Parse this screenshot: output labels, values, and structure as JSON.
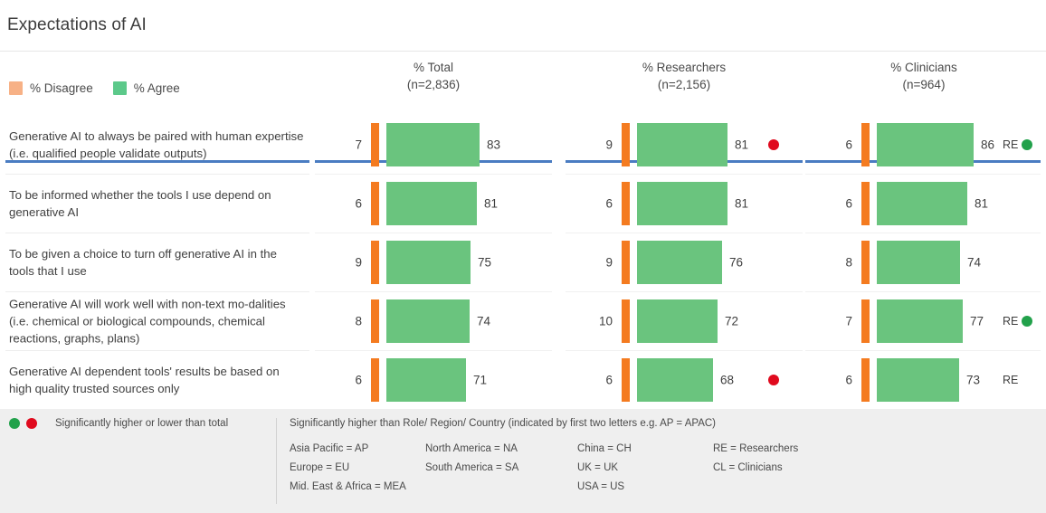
{
  "title": "Expectations of AI",
  "legend": {
    "items": [
      {
        "label": "% Disagree",
        "color": "#f7b186",
        "icon": "square-swatch"
      },
      {
        "label": "% Agree",
        "color": "#5cc98a",
        "icon": "square-swatch"
      }
    ]
  },
  "columns": [
    {
      "key": "total",
      "title": "% Total",
      "sub": "(n=2,836)"
    },
    {
      "key": "researchers",
      "title": "% Researchers",
      "sub": "(n=2,156)"
    },
    {
      "key": "clinicians",
      "title": "% Clinicians",
      "sub": "(n=964)"
    }
  ],
  "rows": [
    {
      "label": "Generative AI to always be paired with human expertise (i.e. qualified people validate outputs)",
      "cells": [
        {
          "disagree": 7,
          "agree": 83,
          "sig_label": "",
          "sig_dot": ""
        },
        {
          "disagree": 9,
          "agree": 81,
          "sig_label": "",
          "sig_dot": "red"
        },
        {
          "disagree": 6,
          "agree": 86,
          "sig_label": "RE",
          "sig_dot": "green"
        }
      ]
    },
    {
      "label": "To be informed whether the tools I use depend on generative AI",
      "cells": [
        {
          "disagree": 6,
          "agree": 81,
          "sig_label": "",
          "sig_dot": ""
        },
        {
          "disagree": 6,
          "agree": 81,
          "sig_label": "",
          "sig_dot": ""
        },
        {
          "disagree": 6,
          "agree": 81,
          "sig_label": "",
          "sig_dot": ""
        }
      ]
    },
    {
      "label": "To be given a choice to turn off generative AI in the tools that I use",
      "cells": [
        {
          "disagree": 9,
          "agree": 75,
          "sig_label": "",
          "sig_dot": ""
        },
        {
          "disagree": 9,
          "agree": 76,
          "sig_label": "",
          "sig_dot": ""
        },
        {
          "disagree": 8,
          "agree": 74,
          "sig_label": "",
          "sig_dot": ""
        }
      ]
    },
    {
      "label": "Generative AI will work well with non-text mo-dalities (i.e. chemical or biological compounds, chemical reactions, graphs, plans)",
      "cells": [
        {
          "disagree": 8,
          "agree": 74,
          "sig_label": "",
          "sig_dot": ""
        },
        {
          "disagree": 10,
          "agree": 72,
          "sig_label": "",
          "sig_dot": ""
        },
        {
          "disagree": 7,
          "agree": 77,
          "sig_label": "RE",
          "sig_dot": "green"
        }
      ]
    },
    {
      "label": "Generative AI dependent tools' results be based on high quality trusted sources only",
      "cells": [
        {
          "disagree": 6,
          "agree": 71,
          "sig_label": "",
          "sig_dot": ""
        },
        {
          "disagree": 6,
          "agree": 68,
          "sig_label": "",
          "sig_dot": "red"
        },
        {
          "disagree": 6,
          "agree": 73,
          "sig_label": "RE",
          "sig_dot": ""
        }
      ]
    }
  ],
  "footer": {
    "sig_note": "Significantly higher or lower than total",
    "sig_dots": [
      "green",
      "red"
    ],
    "heading": "Significantly higher than Role/ Region/ Country (indicated by first two letters e.g. AP = APAC)",
    "key_columns": [
      [
        "Asia Pacific = AP",
        "Europe = EU",
        "Mid. East & Africa = MEA"
      ],
      [
        "North America  = NA",
        "South America = SA"
      ],
      [
        "China = CH",
        "UK = UK",
        "USA = US"
      ],
      [
        "RE = Researchers",
        "CL = Clinicians"
      ]
    ]
  },
  "chart_data": {
    "type": "bar",
    "title": "Expectations of AI",
    "orientation": "horizontal",
    "stacked": false,
    "xlabel": "",
    "ylabel": "",
    "xlim": [
      0,
      100
    ],
    "grid": false,
    "legend_position": "top-left",
    "panels": [
      "% Total (n=2,836)",
      "% Researchers (n=2,156)",
      "% Clinicians (n=964)"
    ],
    "categories": [
      "Generative AI to always be paired with human expertise (i.e. qualified people validate outputs)",
      "To be informed whether the tools I use depend on generative AI",
      "To be given a choice to turn off generative AI in the tools that I use",
      "Generative AI will work well with non-text modalities (i.e. chemical or biological compounds, chemical reactions, graphs, plans)",
      "Generative AI dependent tools' results be based on high quality trusted sources only"
    ],
    "series": [
      {
        "name": "% Disagree — Total",
        "panel": "% Total (n=2,836)",
        "color": "#f47b20",
        "values": [
          7,
          6,
          9,
          8,
          6
        ]
      },
      {
        "name": "% Agree — Total",
        "panel": "% Total (n=2,836)",
        "color": "#6ac47e",
        "values": [
          83,
          81,
          75,
          74,
          71
        ]
      },
      {
        "name": "% Disagree — Researchers",
        "panel": "% Researchers (n=2,156)",
        "color": "#f47b20",
        "values": [
          9,
          6,
          9,
          10,
          6
        ]
      },
      {
        "name": "% Agree — Researchers",
        "panel": "% Researchers (n=2,156)",
        "color": "#6ac47e",
        "values": [
          81,
          81,
          76,
          72,
          68
        ]
      },
      {
        "name": "% Disagree — Clinicians",
        "panel": "% Clinicians (n=964)",
        "color": "#f47b20",
        "values": [
          6,
          6,
          8,
          7,
          6
        ]
      },
      {
        "name": "% Agree — Clinicians",
        "panel": "% Clinicians (n=964)",
        "color": "#6ac47e",
        "values": [
          86,
          81,
          74,
          77,
          73
        ]
      }
    ],
    "annotations": [
      {
        "panel": "% Researchers (n=2,156)",
        "category_index": 0,
        "marker": "red-dot"
      },
      {
        "panel": "% Researchers (n=2,156)",
        "category_index": 4,
        "marker": "red-dot"
      },
      {
        "panel": "% Clinicians (n=964)",
        "category_index": 0,
        "marker": "green-dot",
        "label": "RE"
      },
      {
        "panel": "% Clinicians (n=964)",
        "category_index": 3,
        "marker": "green-dot",
        "label": "RE"
      },
      {
        "panel": "% Clinicians (n=964)",
        "category_index": 4,
        "marker": "",
        "label": "RE"
      }
    ]
  }
}
